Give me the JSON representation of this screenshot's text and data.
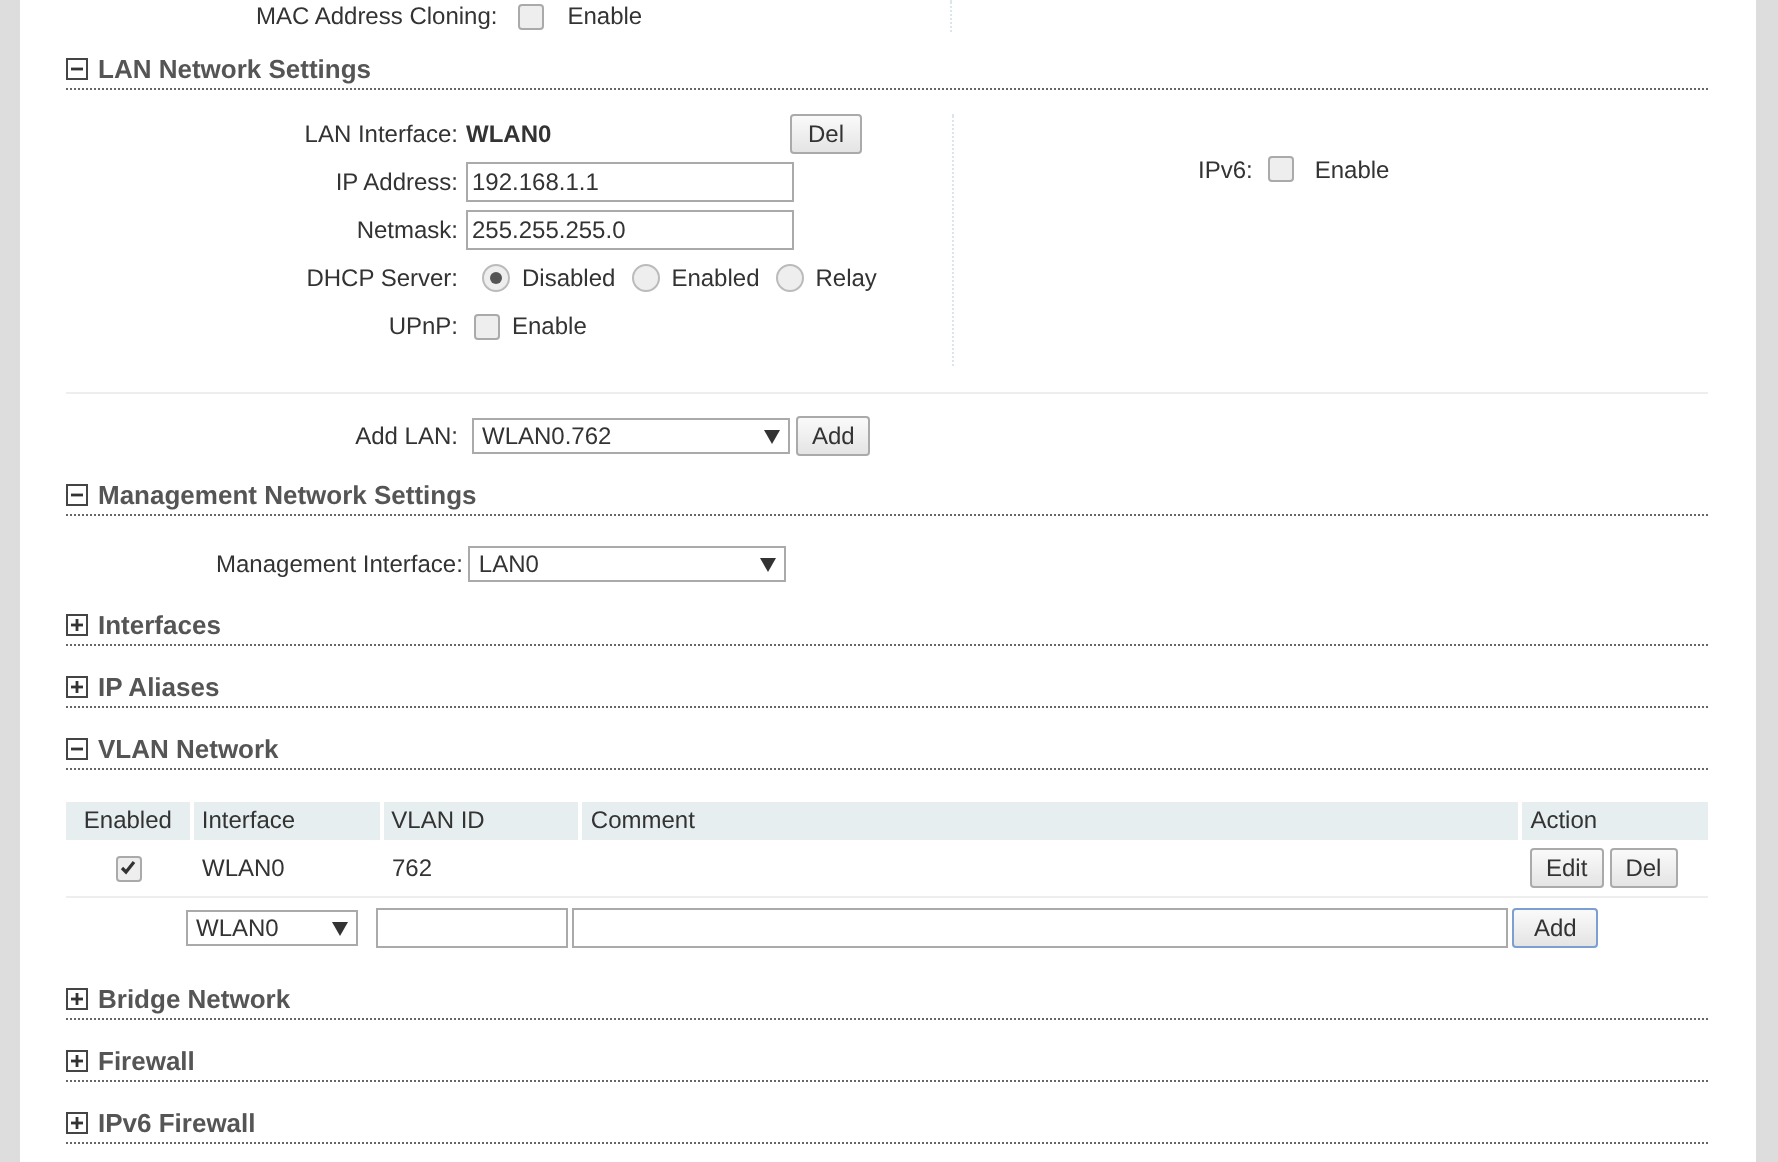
{
  "top_row": {
    "label": "MAC Address Cloning:",
    "option": "Enable",
    "checked": false
  },
  "sections": [
    {
      "kind": "lan",
      "title": "LAN Network Settings",
      "expanded": true,
      "lan_interface": {
        "label": "LAN Interface:",
        "value": "WLAN0",
        "button": "Del"
      },
      "ip_address": {
        "label": "IP Address:",
        "value": "192.168.1.1"
      },
      "netmask": {
        "label": "Netmask:",
        "value": "255.255.255.0"
      },
      "dhcp": {
        "label": "DHCP Server:",
        "options": [
          {
            "label": "Disabled",
            "selected": true
          },
          {
            "label": "Enabled",
            "selected": false
          },
          {
            "label": "Relay",
            "selected": false
          }
        ]
      },
      "upnp": {
        "label": "UPnP:",
        "option": "Enable",
        "checked": false
      },
      "ipv6": {
        "label": "IPv6:",
        "option": "Enable",
        "checked": false
      },
      "add_lan": {
        "label": "Add LAN:",
        "value": "WLAN0.762",
        "button": "Add"
      }
    },
    {
      "kind": "management",
      "title": "Management Network Settings",
      "expanded": true,
      "field": {
        "label": "Management Interface:",
        "value": "LAN0"
      }
    },
    {
      "kind": "collapsed",
      "title": "Interfaces",
      "expanded": false
    },
    {
      "kind": "collapsed",
      "title": "IP Aliases",
      "expanded": false
    },
    {
      "kind": "vlan",
      "title": "VLAN Network",
      "expanded": true,
      "columns": [
        "Enabled",
        "Interface",
        "VLAN ID",
        "Comment",
        "Action"
      ],
      "rows": [
        {
          "enabled": true,
          "interface": "WLAN0",
          "vlan_id": "762",
          "buttons": [
            "Edit",
            "Del"
          ]
        }
      ],
      "new_row": {
        "interface": "WLAN0",
        "button": "Add"
      }
    },
    {
      "kind": "collapsed",
      "title": "Bridge Network",
      "expanded": false
    },
    {
      "kind": "collapsed",
      "title": "Firewall",
      "expanded": false
    },
    {
      "kind": "collapsed",
      "title": "IPv6 Firewall",
      "expanded": false
    }
  ]
}
